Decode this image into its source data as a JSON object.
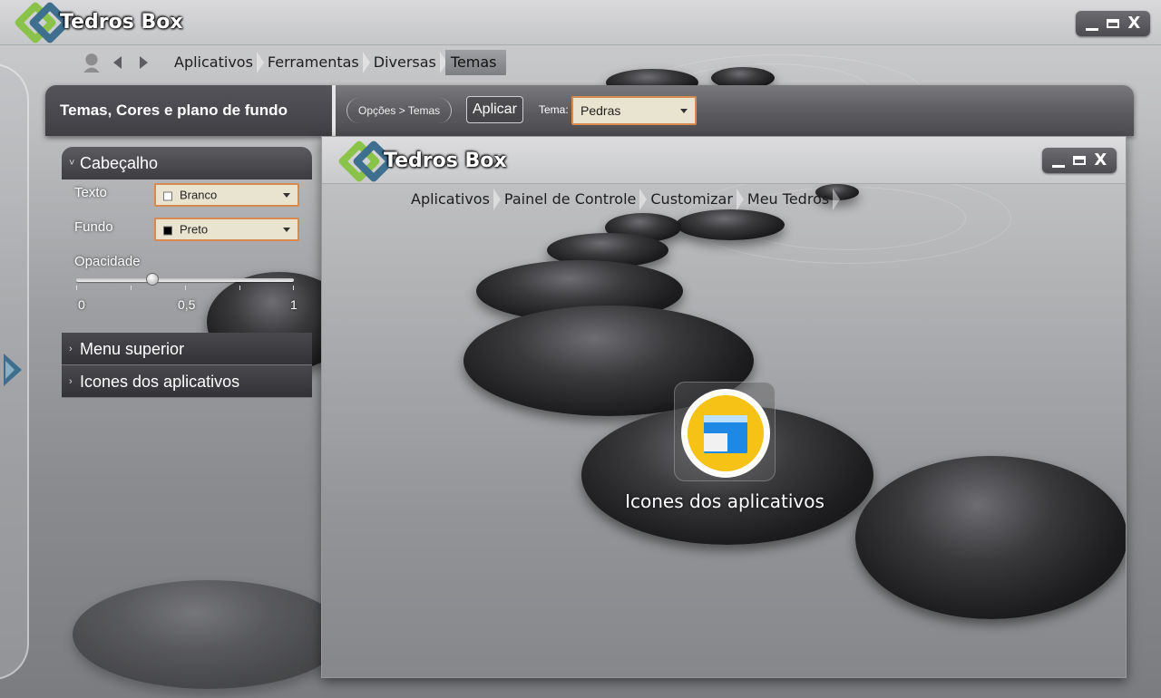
{
  "window": {
    "title": "Tedros Box",
    "controls": {
      "minimize": "_",
      "maximize": "▬",
      "close": "X"
    }
  },
  "top_nav": {
    "items": [
      {
        "label": "Aplicativos"
      },
      {
        "label": "Ferramentas"
      },
      {
        "label": "Diversas"
      },
      {
        "label": "Temas",
        "active": true
      }
    ]
  },
  "settings": {
    "title": "Temas, Cores e plano de fundo",
    "path": "Opções > Temas",
    "apply_label": "Aplicar",
    "theme_label": "Tema:",
    "theme_value": "Pedras"
  },
  "left_panel": {
    "sections": {
      "header": "Cabeçalho",
      "menu": "Menu superior",
      "icons": "Icones dos aplicativos"
    },
    "fields": {
      "text_label": "Texto",
      "text_value": "Branco",
      "text_swatch": "#ffffff",
      "background_label": "Fundo",
      "background_value": "Preto",
      "background_swatch": "#000000",
      "opacity_label": "Opacidade",
      "opacity_value": 0.35,
      "opacity_min": "0",
      "opacity_mid": "0,5",
      "opacity_max": "1"
    }
  },
  "preview": {
    "title": "Tedros Box",
    "controls": {
      "minimize": "_",
      "maximize": "▬",
      "close": "X"
    },
    "nav": [
      {
        "label": "Aplicativos"
      },
      {
        "label": "Painel de Controle"
      },
      {
        "label": "Customizar"
      },
      {
        "label": "Meu Tedros"
      }
    ],
    "app_tile_label": "Icones dos aplicativos"
  },
  "colors": {
    "logo_green": "#8bc34a",
    "logo_blue": "#3e6f8e",
    "combo_border": "#d88a4e",
    "combo_bg": "#e8e4cf",
    "app_icon_yellow": "#f6c215",
    "app_icon_blue": "#1e88e5"
  }
}
